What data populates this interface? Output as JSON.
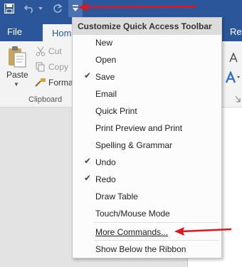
{
  "titlebar": {
    "save_icon": "save-icon",
    "undo_icon": "undo-icon",
    "redo_icon": "redo-icon",
    "customize_icon": "dropdown-icon"
  },
  "tabs": {
    "file": "File",
    "home": "Home",
    "right_clipped": "Ref"
  },
  "clipboard": {
    "paste": "Paste",
    "cut": "Cut",
    "copy": "Copy",
    "format_painter": "Forma",
    "group_label": "Clipboard"
  },
  "menu": {
    "title": "Customize Quick Access Toolbar",
    "items": [
      {
        "label": "New",
        "checked": false
      },
      {
        "label": "Open",
        "checked": false
      },
      {
        "label": "Save",
        "checked": true
      },
      {
        "label": "Email",
        "checked": false
      },
      {
        "label": "Quick Print",
        "checked": false
      },
      {
        "label": "Print Preview and Print",
        "checked": false
      },
      {
        "label": "Spelling & Grammar",
        "checked": false
      },
      {
        "label": "Undo",
        "checked": true
      },
      {
        "label": "Redo",
        "checked": true
      },
      {
        "label": "Draw Table",
        "checked": false
      },
      {
        "label": "Touch/Mouse Mode",
        "checked": false
      }
    ],
    "more_commands": "More Commands...",
    "show_below": "Show Below the Ribbon"
  },
  "colors": {
    "title_bar": "#2b579a",
    "annotation_arrow": "#e0161e",
    "ribbon": "#f3f3f3"
  }
}
